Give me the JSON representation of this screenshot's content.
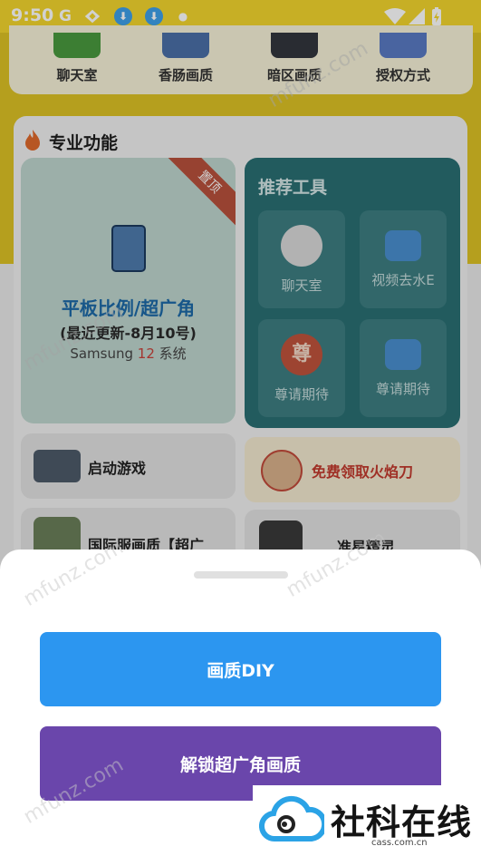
{
  "status_bar": {
    "time": "9:50",
    "icons": [
      "google-icon",
      "network-icon",
      "download-icon",
      "download-icon",
      "dot-icon",
      "wifi-icon",
      "signal-icon",
      "battery-charging-icon"
    ]
  },
  "top_menu": {
    "items": [
      {
        "label": "聊天室",
        "icon": "chat-app-icon"
      },
      {
        "label": "香肠画质",
        "icon": "sausage-game-icon"
      },
      {
        "label": "暗区画质",
        "icon": "dark-zone-game-icon"
      },
      {
        "label": "授权方式",
        "icon": "auth-icon"
      }
    ]
  },
  "pro_section": {
    "title": "专业功能",
    "featured": {
      "badge": "置顶",
      "title": "平板比例/超广角",
      "subtitle": "(最近更新-8月10号)",
      "system_prefix": "Samsung ",
      "system_num": "12",
      "system_suffix": " 系统"
    },
    "recommend": {
      "title": "推荐工具",
      "tiles": [
        {
          "label": "聊天室",
          "icon": "cat-sunglasses-icon"
        },
        {
          "label": "视频去水E",
          "icon": "video-camera-icon"
        },
        {
          "label": "尊请期待",
          "icon": "zun-badge-icon"
        },
        {
          "label": "尊请期待",
          "icon": "video-camera-icon"
        }
      ]
    },
    "rows": [
      {
        "label": "启动游戏",
        "icon": "gun-icon"
      },
      {
        "label": "免费领取火焰刀",
        "icon": "fan-blade-icon"
      },
      {
        "label": "国际服画质【超广",
        "icon": "soldier-icon"
      },
      {
        "label": "准星精灵",
        "icon": "crosshair-icon"
      }
    ]
  },
  "sheet": {
    "button_diy": "画质DIY",
    "button_unlock": "解锁超广角画质"
  },
  "watermark": {
    "brand": "社科在线",
    "url": "cass.com.cn",
    "mark": "mfunz.com"
  },
  "colors": {
    "status_yellow": "#f3d62e",
    "diy_blue": "#2c96f0",
    "unlock_purple": "#6a46ab",
    "recommend_teal": "#2a6f73"
  }
}
